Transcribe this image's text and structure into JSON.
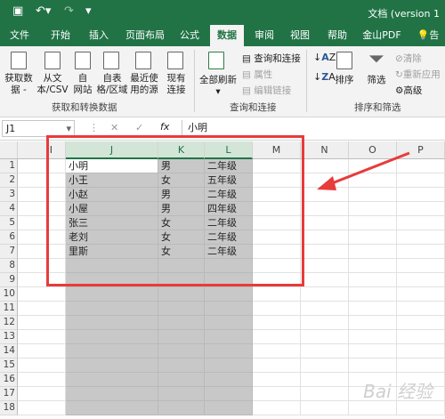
{
  "titlebar": {
    "doc": "文档 (version 1"
  },
  "tabs": [
    "文件",
    "开始",
    "插入",
    "页面布局",
    "公式",
    "数据",
    "审阅",
    "视图",
    "帮助",
    "金山PDF",
    "告诉"
  ],
  "ribbon": {
    "get": [
      "获取数",
      "从文",
      "自",
      "自表",
      "最近使",
      "现有"
    ],
    "get2": [
      "据 -",
      "本/CSV",
      "网站",
      "格/区域",
      "用的源",
      "连接"
    ],
    "grp1": "获取和转换数据",
    "refresh": "全部刷新",
    "q1": "查询和连接",
    "q2": "属性",
    "q3": "编辑链接",
    "grp2": "查询和连接",
    "sort": "排序",
    "filter": "筛选",
    "f1": "清除",
    "f2": "重新应用",
    "f3": "高级",
    "grp3": "排序和筛选"
  },
  "formula": {
    "name": "J1",
    "fx": "fx",
    "value": "小明"
  },
  "columns": [
    "J",
    "K",
    "L",
    "M",
    "N",
    "O",
    "P"
  ],
  "rows": [
    "1",
    "2",
    "3",
    "4",
    "5",
    "6",
    "7",
    "8",
    "9",
    "10",
    "11",
    "12",
    "13",
    "14",
    "15",
    "16",
    "17",
    "18"
  ],
  "table": [
    [
      "小明",
      "男",
      "二年级"
    ],
    [
      "小王",
      "女",
      "五年级"
    ],
    [
      "小赵",
      "男",
      "二年级"
    ],
    [
      "小屋",
      "男",
      "四年级"
    ],
    [
      "张三",
      "女",
      "二年级"
    ],
    [
      "老刘",
      "女",
      "二年级"
    ],
    [
      "里斯",
      "女",
      "二年级"
    ]
  ],
  "watermark": "Bai 经验"
}
